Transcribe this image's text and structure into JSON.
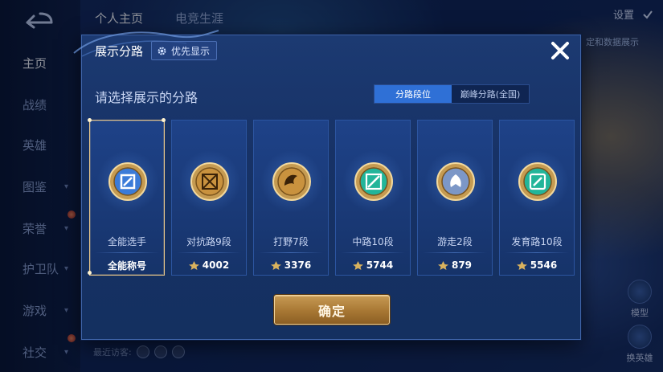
{
  "background": {
    "nav_items": [
      {
        "label": "主页",
        "active": true,
        "chevron": false
      },
      {
        "label": "战绩",
        "active": false,
        "chevron": false
      },
      {
        "label": "英雄",
        "active": false,
        "chevron": false
      },
      {
        "label": "图鉴",
        "active": false,
        "chevron": true
      },
      {
        "label": "荣誉",
        "active": false,
        "chevron": true
      },
      {
        "label": "护卫队",
        "active": false,
        "chevron": true
      },
      {
        "label": "游戏",
        "active": false,
        "chevron": true
      },
      {
        "label": "社交",
        "active": false,
        "chevron": true
      }
    ],
    "tabs": [
      "个人主页",
      "电竞生涯"
    ],
    "settings_label": "设置",
    "hint_text": "定和数据展示",
    "recent_visitors_label": "最近访客:",
    "side_buttons": [
      "模型",
      "换英雄"
    ]
  },
  "modal": {
    "title": "展示分路",
    "priority_button": "优先显示",
    "subtitle": "请选择展示的分路",
    "segments": [
      "分路段位",
      "巅峰分路(全国)"
    ],
    "active_segment": 0,
    "cards": [
      {
        "rank": "全能选手",
        "bottom": "全能称号",
        "selected": true,
        "icon": "all-round-badge-icon",
        "color": "#3b7bd8"
      },
      {
        "rank": "对抗路9段",
        "bottom": "4002",
        "selected": false,
        "icon": "clash-lane-badge-icon",
        "color": "#c9923e"
      },
      {
        "rank": "打野7段",
        "bottom": "3376",
        "selected": false,
        "icon": "jungle-badge-icon",
        "color": "#c9923e"
      },
      {
        "rank": "中路10段",
        "bottom": "5744",
        "selected": false,
        "icon": "mid-lane-badge-icon",
        "color": "#22b59a"
      },
      {
        "rank": "游走2段",
        "bottom": "879",
        "selected": false,
        "icon": "roam-badge-icon",
        "color": "#7c97c7"
      },
      {
        "rank": "发育路10段",
        "bottom": "5546",
        "selected": false,
        "icon": "farm-lane-badge-icon",
        "color": "#22b59a"
      }
    ],
    "confirm_label": "确定"
  },
  "colors": {
    "accent_blue": "#2f70d6",
    "gold": "#e9c78a",
    "modal_bg": "#1a3a78"
  }
}
